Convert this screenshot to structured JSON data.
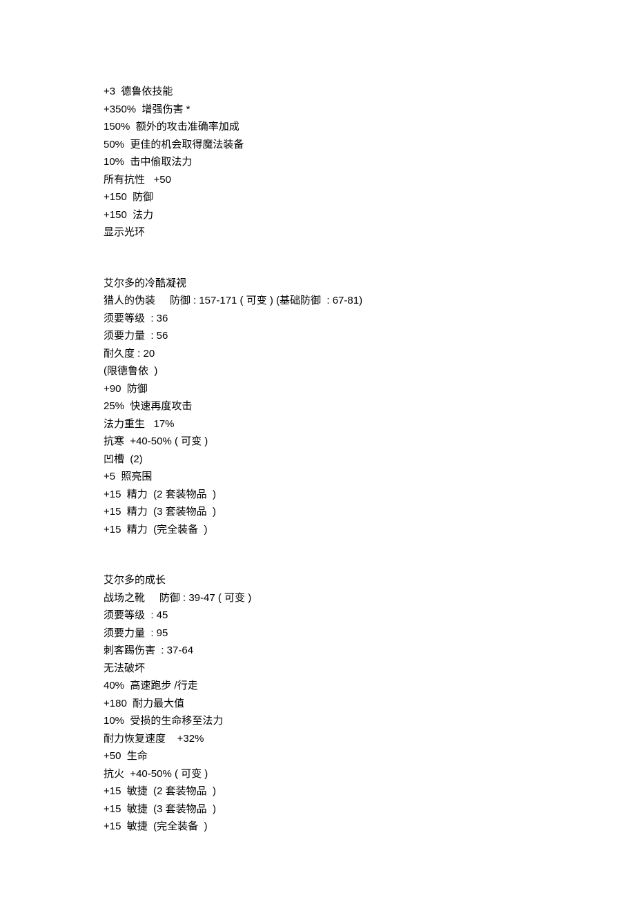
{
  "blocks": [
    {
      "lines": [
        "+3  德鲁依技能",
        "+350%  增强伤害 *",
        "150%  额外的攻击准确率加成",
        "50%  更佳的机会取得魔法装备",
        "10%  击中偷取法力",
        "所有抗性   +50",
        "+150  防御",
        "+150  法力",
        "显示光环"
      ]
    },
    {
      "lines": [
        "艾尔多的冷酷凝视",
        "猎人的伪装     防御 : 157-171 ( 可变 ) (基础防御  : 67-81)",
        "须要等级  : 36",
        "须要力量  : 56",
        "耐久度 : 20",
        "(限德鲁依  )",
        "+90  防御",
        "25%  快速再度攻击",
        "法力重生   17%",
        "抗寒  +40-50% ( 可变 )",
        "凹槽  (2)",
        "+5  照亮围",
        "+15  精力  (2 套装物品  )",
        "+15  精力  (3 套装物品  )",
        "+15  精力  (完全装备  )"
      ]
    },
    {
      "lines": [
        "艾尔多的成长",
        "战场之靴     防御 : 39-47 ( 可变 )",
        "须要等级  : 45",
        "须要力量  : 95",
        "刺客踢伤害  : 37-64",
        "无法破坏",
        "40%  高速跑步 /行走",
        "+180  耐力最大值",
        "10%  受损的生命移至法力",
        "耐力恢复速度    +32%",
        "+50  生命",
        "抗火  +40-50% ( 可变 )",
        "+15  敏捷  (2 套装物品  )",
        "+15  敏捷  (3 套装物品  )",
        "+15  敏捷  (完全装备  )"
      ]
    }
  ]
}
